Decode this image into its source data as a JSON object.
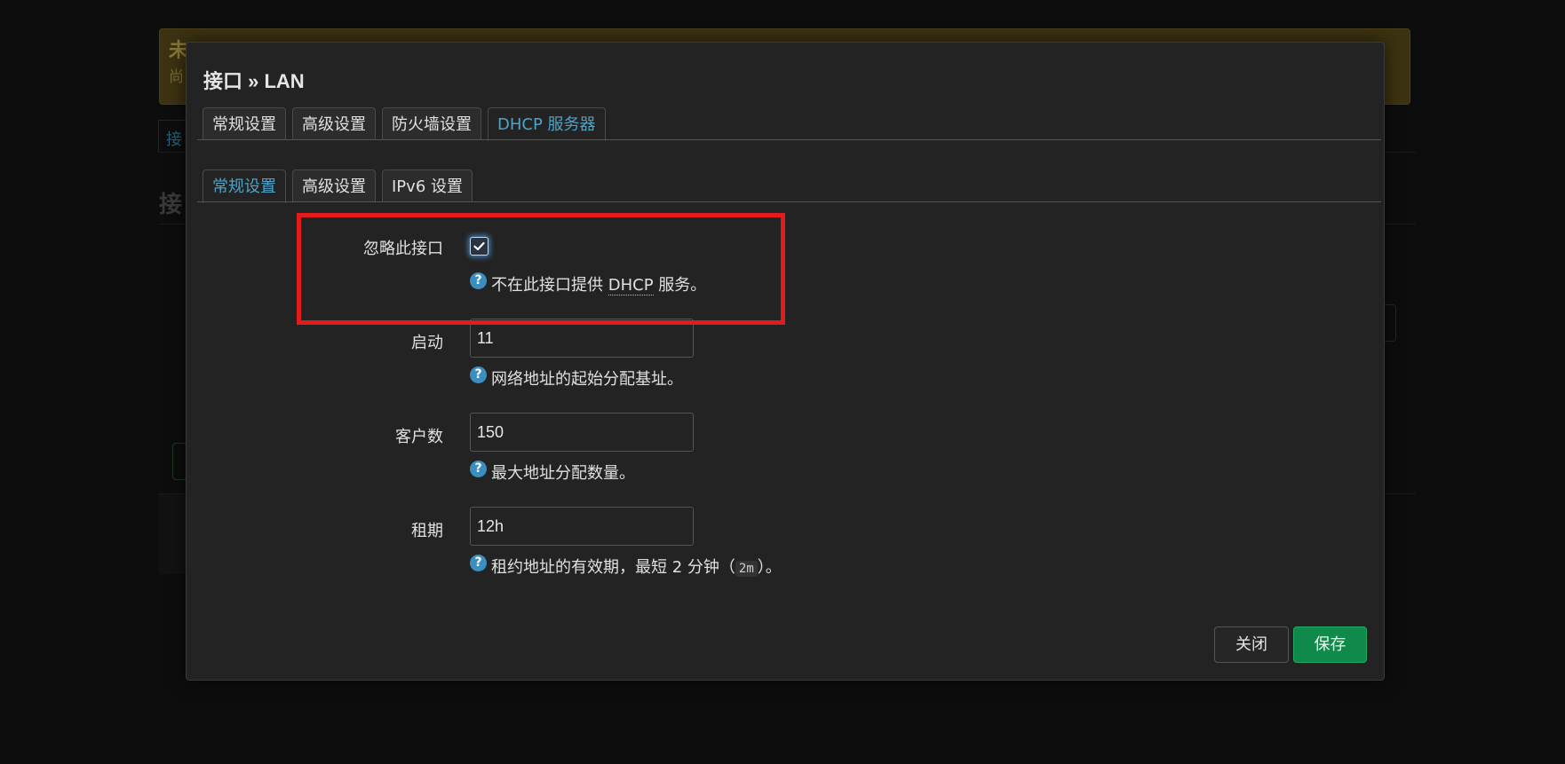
{
  "background": {
    "warning_title": "未",
    "warning_sub": "尚",
    "tab_label": "接",
    "heading": "接"
  },
  "modal": {
    "title": "接口 » LAN",
    "tabs": [
      {
        "label": "常规设置",
        "active": false
      },
      {
        "label": "高级设置",
        "active": false
      },
      {
        "label": "防火墙设置",
        "active": false
      },
      {
        "label": "DHCP 服务器",
        "active": true
      }
    ],
    "subtabs": [
      {
        "label": "常规设置",
        "active": true
      },
      {
        "label": "高级设置",
        "active": false
      },
      {
        "label": "IPv6 设置",
        "active": false
      }
    ],
    "fields": {
      "ignore": {
        "label": "忽略此接口",
        "checked": true,
        "help_prefix": "不在此接口提供 ",
        "help_abbr": "DHCP",
        "help_suffix": " 服务。"
      },
      "start": {
        "label": "启动",
        "value": "11",
        "help": "网络地址的起始分配基址。"
      },
      "limit": {
        "label": "客户数",
        "value": "150",
        "help": "最大地址分配数量。"
      },
      "leasetime": {
        "label": "租期",
        "value": "12h",
        "help_prefix": "租约地址的有效期，最短 2 分钟（",
        "help_code": "2m",
        "help_suffix": "）。"
      }
    },
    "buttons": {
      "close": "关闭",
      "save": "保存"
    }
  },
  "colors": {
    "accent": "#4fa3c7",
    "save": "#0f8a4a",
    "highlight": "#e21c1c",
    "help_icon": "#3a8fc0"
  },
  "icons": {
    "help": "question-circle-icon",
    "check": "checkmark-icon"
  }
}
